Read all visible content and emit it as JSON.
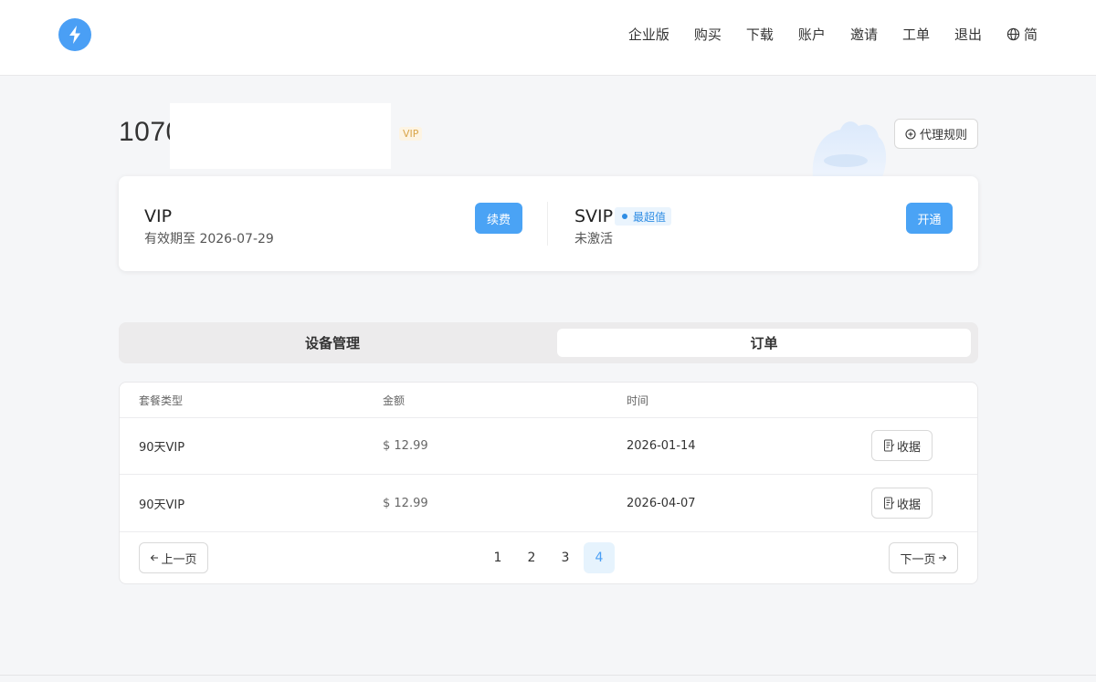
{
  "nav": {
    "items": [
      "企业版",
      "购买",
      "下载",
      "账户",
      "邀请",
      "工单",
      "退出"
    ],
    "language": "简"
  },
  "user": {
    "id_partial": "1070",
    "tag": "VIP",
    "rules_button": "代理规则"
  },
  "plans": {
    "vip": {
      "name": "VIP",
      "status": "有效期至 2026-07-29",
      "button": "续费"
    },
    "svip": {
      "name": "SVIP",
      "badge": "最超值",
      "status": "未激活",
      "button": "开通"
    }
  },
  "tabs": {
    "devices": "设备管理",
    "orders": "订单",
    "active": "订单"
  },
  "orders": {
    "headers": {
      "type": "套餐类型",
      "amount": "金额",
      "time": "时间"
    },
    "rows": [
      {
        "type": "90天VIP",
        "amount": "$ 12.99",
        "time": "2026-01-14",
        "action": "收据"
      },
      {
        "type": "90天VIP",
        "amount": "$ 12.99",
        "time": "2026-04-07",
        "action": "收据"
      }
    ]
  },
  "pagination": {
    "prev": "上一页",
    "next": "下一页",
    "pages": [
      "1",
      "2",
      "3",
      "4"
    ],
    "current": "4"
  },
  "colors": {
    "accent": "#4aa3f5",
    "badge_bg": "#eaf4fd",
    "vip_tag": "#d9a54a"
  },
  "icons": [
    "bolt-icon",
    "globe-icon",
    "plus-circle-icon",
    "receipt-icon",
    "arrow-left-icon",
    "arrow-right-icon"
  ]
}
